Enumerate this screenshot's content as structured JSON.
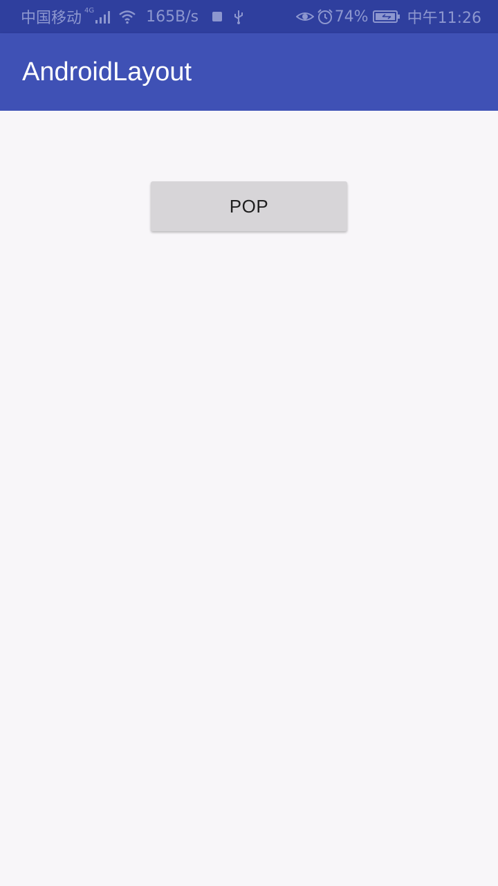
{
  "status_bar": {
    "carrier": "中国移动",
    "network_type": "4G",
    "net_speed": "165B/s",
    "battery_percent": "74%",
    "time": "中午11:26",
    "icons": [
      "signal-icon",
      "wifi-icon",
      "square-icon",
      "usb-icon",
      "eye-icon",
      "alarm-icon",
      "battery-icon"
    ],
    "background_color": "#2f3f9e",
    "text_color": "#8d97cf"
  },
  "app_bar": {
    "title": "AndroidLayout",
    "background_color": "#3f51b5"
  },
  "main": {
    "pop_button_label": "POP",
    "background_color": "#f8f6f9"
  }
}
